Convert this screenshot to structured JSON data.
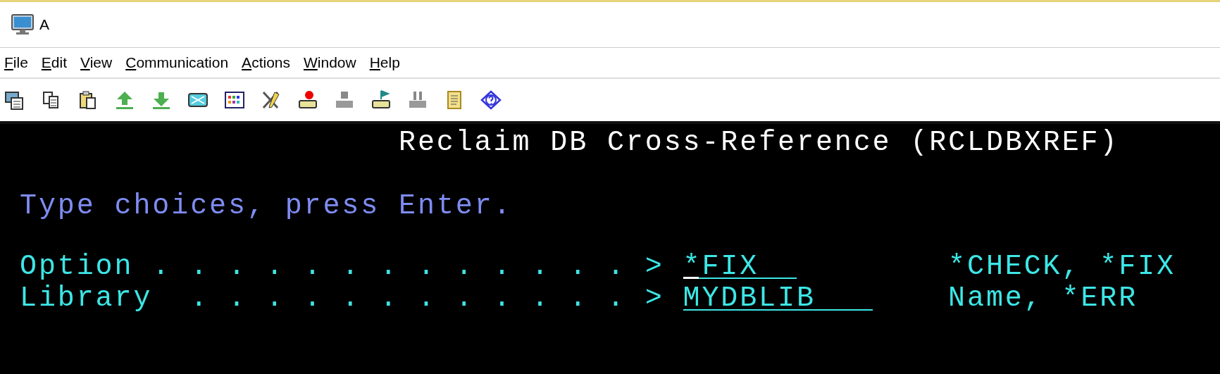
{
  "window": {
    "title": "A"
  },
  "menu": [
    "File",
    "Edit",
    "View",
    "Communication",
    "Actions",
    "Window",
    "Help"
  ],
  "terminal": {
    "title": "Reclaim DB Cross-Reference (RCLDBXREF)",
    "instruction": "Type choices, press Enter.",
    "prompts": [
      {
        "label": "Option . . . . . . . . . . . . . >",
        "value": "*FIX",
        "choices": "*CHECK, *FIX",
        "cursor": true
      },
      {
        "label": "Library  . . . . . . . . . . . . >",
        "value": "MYDBLIB",
        "choices": "Name, *ERR",
        "cursor": false
      }
    ]
  }
}
